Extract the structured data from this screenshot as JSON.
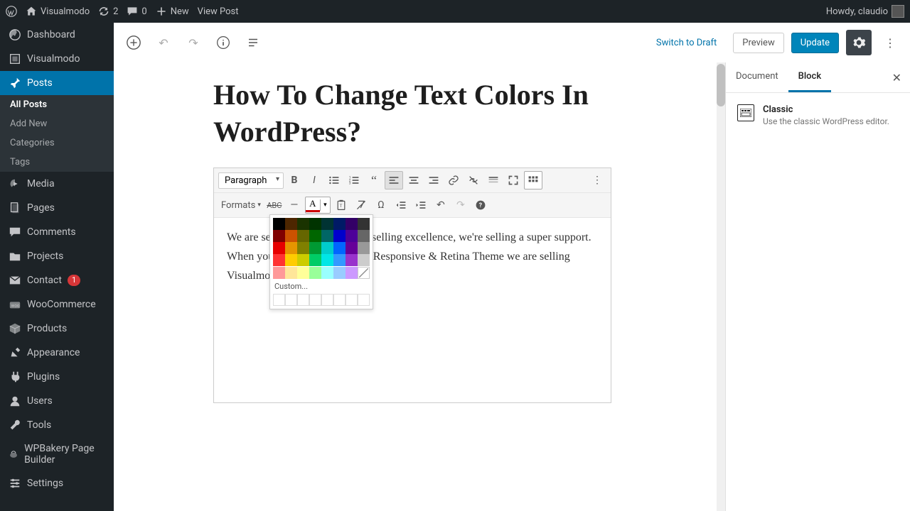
{
  "topbar": {
    "site": "Visualmodo",
    "updates": "2",
    "comments": "0",
    "new": "New",
    "view_post": "View Post",
    "howdy": "Howdy, claudio"
  },
  "sidebar": {
    "items": [
      {
        "label": "Dashboard",
        "icon": "dashboard"
      },
      {
        "label": "Visualmodo",
        "icon": "visualmodo"
      },
      {
        "label": "Posts",
        "icon": "pin",
        "active": true,
        "submenu": [
          {
            "label": "All Posts",
            "active": true
          },
          {
            "label": "Add New"
          },
          {
            "label": "Categories"
          },
          {
            "label": "Tags"
          }
        ]
      },
      {
        "label": "Media",
        "icon": "media"
      },
      {
        "label": "Pages",
        "icon": "pages"
      },
      {
        "label": "Comments",
        "icon": "comments"
      },
      {
        "label": "Projects",
        "icon": "projects"
      },
      {
        "label": "Contact",
        "icon": "contact",
        "badge": "1"
      },
      {
        "label": "WooCommerce",
        "icon": "woo"
      },
      {
        "label": "Products",
        "icon": "products"
      },
      {
        "label": "Appearance",
        "icon": "appearance"
      },
      {
        "label": "Plugins",
        "icon": "plugins"
      },
      {
        "label": "Users",
        "icon": "users"
      },
      {
        "label": "Tools",
        "icon": "tools"
      },
      {
        "label": "WPBakery Page Builder",
        "icon": "wpbakery"
      },
      {
        "label": "Settings",
        "icon": "settings"
      }
    ]
  },
  "editor": {
    "switch_to_draft": "Switch to Draft",
    "preview": "Preview",
    "update": "Update",
    "title": "How To Change Text Colors In WordPress?",
    "paragraph_dropdown": "Paragraph",
    "formats_dropdown": "Formats",
    "content": "We are selling simplicity, we're selling excellence, we're selling a super support. When you buy a Multi-Purpose Responsive & Retina Theme we are selling Visualmodo."
  },
  "color_popup": {
    "custom_label": "Custom...",
    "grid_colors": [
      "#000000",
      "#4d2600",
      "#1a3300",
      "#003300",
      "#003333",
      "#001a66",
      "#330066",
      "#333333",
      "#800000",
      "#cc5200",
      "#666600",
      "#006600",
      "#006666",
      "#0000cc",
      "#4d0099",
      "#666666",
      "#e60000",
      "#e69500",
      "#808000",
      "#009933",
      "#00cccc",
      "#0066ff",
      "#660099",
      "#999999",
      "#ff3333",
      "#ffcc00",
      "#cccc00",
      "#00cc66",
      "#00e6e6",
      "#3399ff",
      "#9933cc",
      "#cccccc",
      "#ff9999",
      "#ffe699",
      "#ffff99",
      "#99ff99",
      "#99ffff",
      "#99ccff",
      "#cc99ff",
      "#ffffff"
    ]
  },
  "inspector": {
    "tab_document": "Document",
    "tab_block": "Block",
    "block_title": "Classic",
    "block_desc": "Use the classic WordPress editor."
  }
}
